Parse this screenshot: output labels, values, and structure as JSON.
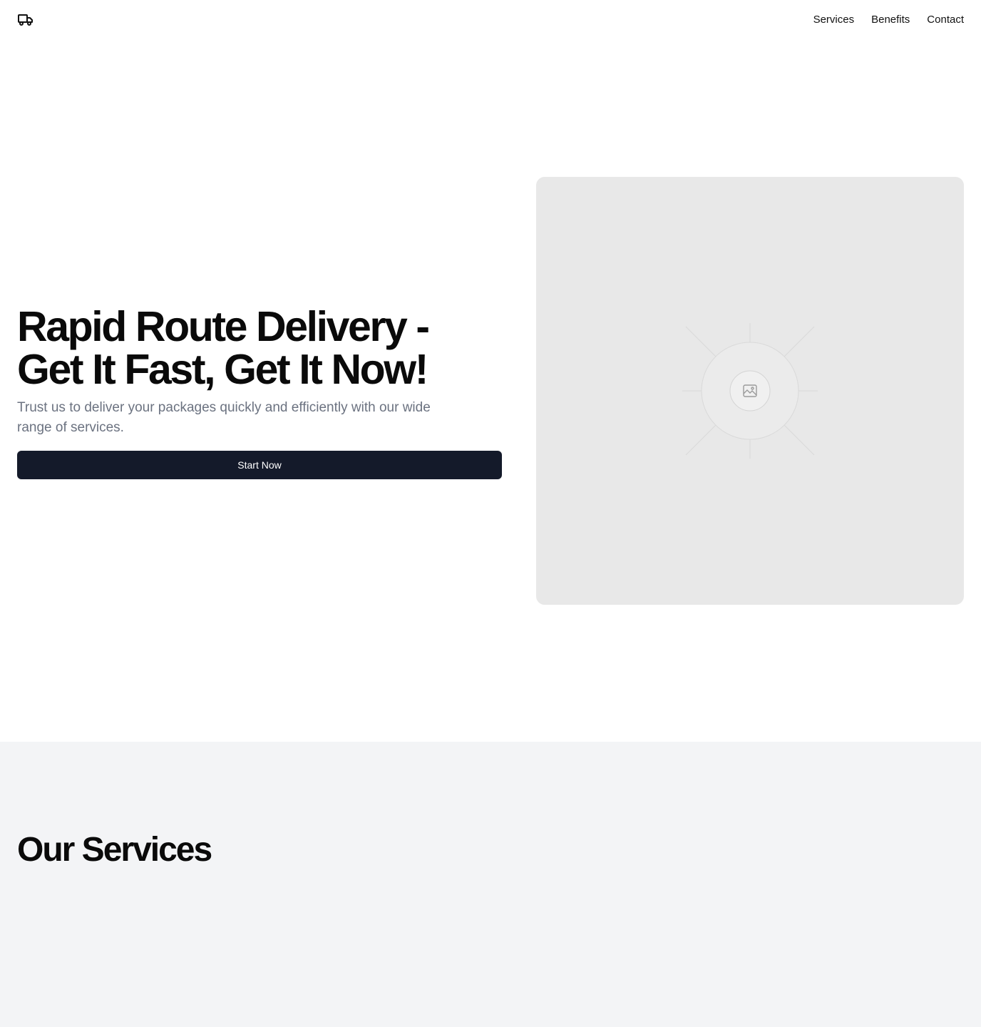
{
  "header": {
    "logo_icon": "truck-icon",
    "nav": [
      {
        "label": "Services"
      },
      {
        "label": "Benefits"
      },
      {
        "label": "Contact"
      }
    ]
  },
  "hero": {
    "title": "Rapid Route Delivery - Get It Fast, Get It Now!",
    "subtitle": "Trust us to deliver your packages quickly and efficiently with our wide range of services.",
    "cta_label": "Start Now",
    "image_icon": "image-placeholder-icon"
  },
  "services": {
    "title": "Our Services"
  },
  "colors": {
    "cta_bg": "#141a2a",
    "subtitle_text": "#6b7280",
    "placeholder_bg": "#e8e8e8",
    "services_bg": "#f3f4f6"
  }
}
